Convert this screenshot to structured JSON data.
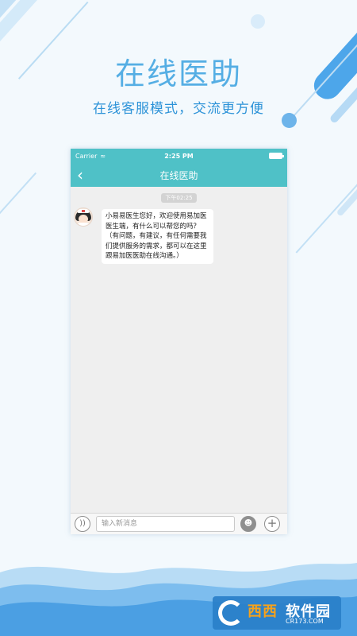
{
  "promo": {
    "headline": "在线医助",
    "subline": "在线客服模式，交流更方便"
  },
  "status_bar": {
    "carrier": "Carrier",
    "time": "2:25 PM"
  },
  "nav": {
    "title": "在线医助"
  },
  "chat": {
    "timestamp": "下午02:25",
    "messages": [
      {
        "sender_icon": "nurse-avatar",
        "text": "小易易医生您好，欢迎使用易加医医生端，有什么可以帮您的吗？（有问题，有建议，有任何需要我们提供服务的需求，都可以在这里跟易加医医助在线沟通。）"
      }
    ]
  },
  "input_bar": {
    "placeholder": "输入新消息",
    "voice_icon": "voice-icon",
    "emoji_icon": "emoji-icon",
    "plus_icon": "plus-icon"
  },
  "watermark": {
    "brand_a": "西西",
    "brand_b": "软件园",
    "url": "CR173.COM"
  },
  "colors": {
    "accent": "#4fc1c7",
    "headline": "#55aee4",
    "subline": "#2d93d8"
  }
}
